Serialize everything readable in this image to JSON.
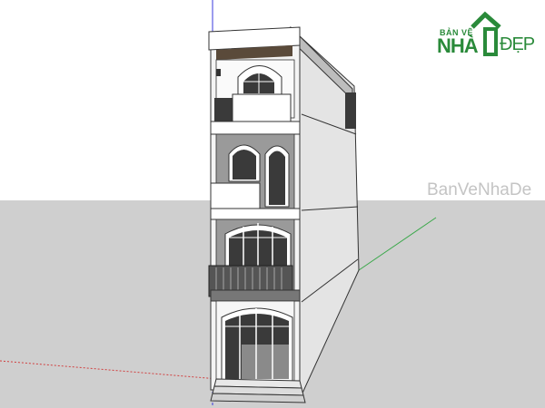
{
  "app": {
    "viewport_label": "SketchUp 3D model viewport - townhouse"
  },
  "logo": {
    "top_text": "BẢN VẼ",
    "big_text": "NHÀ",
    "right_text": "ĐẸP",
    "icon": "house-icon",
    "color": "#2a8a3a"
  },
  "watermark": {
    "text": "BanVeNhaDe"
  },
  "colors": {
    "sky": "#ffffff",
    "ground": "#cfcfcf",
    "wall": "#f2f2f2",
    "wall_shade": "#dcdcdc",
    "dark_panel": "#7a7a7a",
    "glass": "#3a3a3a",
    "axis_green": "#3aa84a",
    "axis_blue": "#3a3adc",
    "axis_red": "#d04040"
  }
}
